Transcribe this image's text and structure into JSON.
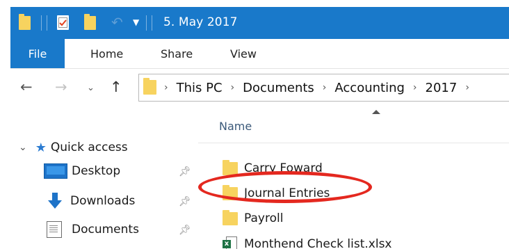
{
  "window": {
    "title": "5. May 2017"
  },
  "quick_access_toolbar": {
    "icons": [
      "folder-icon",
      "properties-icon",
      "new-folder-icon",
      "undo-icon",
      "customize-dropdown-icon"
    ]
  },
  "ribbon": {
    "tabs": [
      {
        "label": "File",
        "active": true
      },
      {
        "label": "Home"
      },
      {
        "label": "Share"
      },
      {
        "label": "View"
      }
    ]
  },
  "address_bar": {
    "breadcrumbs": [
      "This PC",
      "Documents",
      "Accounting",
      "2017"
    ]
  },
  "nav_pane": {
    "quick_access_label": "Quick access",
    "items": [
      {
        "label": "Desktop",
        "icon": "desktop-icon",
        "pinned": true
      },
      {
        "label": "Downloads",
        "icon": "downloads-icon",
        "pinned": true
      },
      {
        "label": "Documents",
        "icon": "documents-icon",
        "pinned": true
      }
    ]
  },
  "file_list": {
    "column_header": "Name",
    "items": [
      {
        "name": "Carry Foward",
        "type": "folder"
      },
      {
        "name": "Journal Entries",
        "type": "folder",
        "highlighted": true
      },
      {
        "name": "Payroll",
        "type": "folder"
      },
      {
        "name": "Monthend Check list.xlsx",
        "type": "xlsx"
      }
    ]
  },
  "colors": {
    "title_bar": "#1979ca",
    "folder": "#f7d35f",
    "highlight_ring": "#e4281f"
  }
}
